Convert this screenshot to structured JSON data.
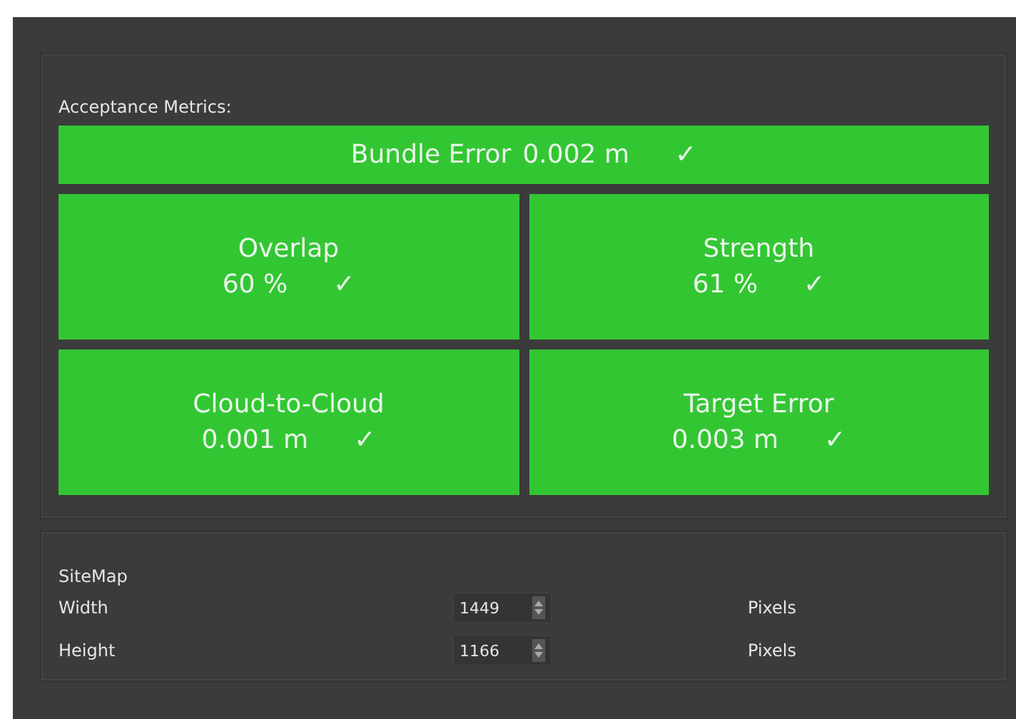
{
  "acceptance_metrics": {
    "label": "Acceptance Metrics:",
    "bundle": {
      "name": "Bundle Error",
      "value": "0.002 m",
      "mark": "✓",
      "passed": true
    },
    "tiles": [
      {
        "name": "Overlap",
        "value": "60 %",
        "mark": "✓",
        "passed": true
      },
      {
        "name": "Strength",
        "value": "61 %",
        "mark": "✓",
        "passed": true
      },
      {
        "name": "Cloud-to-Cloud",
        "value": "0.001 m",
        "mark": "✓",
        "passed": true
      },
      {
        "name": "Target Error",
        "value": "0.003 m",
        "mark": "✓",
        "passed": true
      }
    ]
  },
  "sitemap": {
    "title": "SiteMap",
    "fields": [
      {
        "label": "Width",
        "value": "1449",
        "unit": "Pixels"
      },
      {
        "label": "Height",
        "value": "1166",
        "unit": "Pixels"
      }
    ]
  }
}
